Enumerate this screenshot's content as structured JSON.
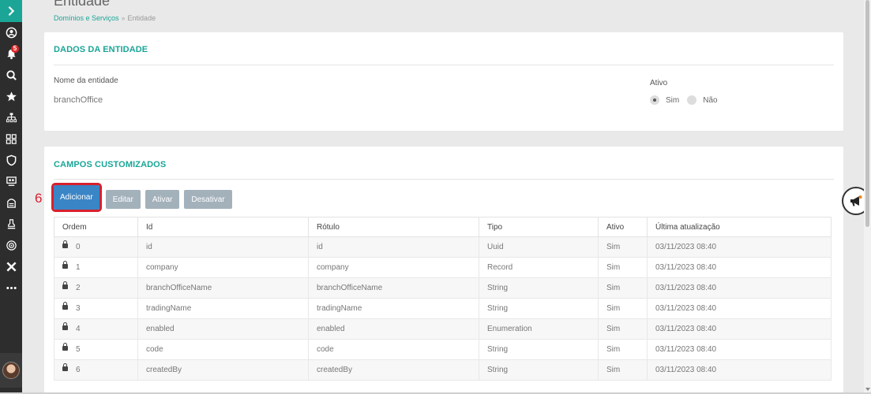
{
  "header": {
    "title": "Entidade",
    "breadcrumb": {
      "link": "Domínios e Serviços",
      "separator": "»",
      "current": "Entidade"
    }
  },
  "sidebar": {
    "notification_count": "5",
    "icons": [
      "user-circle-icon",
      "bell-icon",
      "search-icon",
      "star-icon",
      "hierarchy-icon",
      "team-icon",
      "shield-icon",
      "monitor-users-icon",
      "archive-icon",
      "stamp-icon",
      "target-icon",
      "x-icon",
      "more-icon"
    ]
  },
  "entity": {
    "section_title": "DADOS DA ENTIDADE",
    "name_label": "Nome da entidade",
    "name_value": "branchOffice",
    "active_label": "Ativo",
    "active_options": {
      "yes": "Sim",
      "no": "Não"
    },
    "active_selected": "Sim"
  },
  "custom_fields": {
    "section_title": "CAMPOS CUSTOMIZADOS",
    "step_number": "6",
    "buttons": {
      "add": "Adicionar",
      "edit": "Editar",
      "activate": "Ativar",
      "deactivate": "Desativar"
    },
    "columns": {
      "order": "Ordem",
      "id": "Id",
      "label": "Rótulo",
      "type": "Tipo",
      "active": "Ativo",
      "updated": "Última atualização"
    },
    "rows": [
      {
        "order": "0",
        "id": "id",
        "label": "id",
        "type": "Uuid",
        "active": "Sim",
        "updated": "03/11/2023 08:40"
      },
      {
        "order": "1",
        "id": "company",
        "label": "company",
        "type": "Record",
        "active": "Sim",
        "updated": "03/11/2023 08:40"
      },
      {
        "order": "2",
        "id": "branchOfficeName",
        "label": "branchOfficeName",
        "type": "String",
        "active": "Sim",
        "updated": "03/11/2023 08:40"
      },
      {
        "order": "3",
        "id": "tradingName",
        "label": "tradingName",
        "type": "String",
        "active": "Sim",
        "updated": "03/11/2023 08:40"
      },
      {
        "order": "4",
        "id": "enabled",
        "label": "enabled",
        "type": "Enumeration",
        "active": "Sim",
        "updated": "03/11/2023 08:40"
      },
      {
        "order": "5",
        "id": "code",
        "label": "code",
        "type": "String",
        "active": "Sim",
        "updated": "03/11/2023 08:40"
      },
      {
        "order": "6",
        "id": "createdBy",
        "label": "createdBy",
        "type": "String",
        "active": "Sim",
        "updated": "03/11/2023 08:40"
      }
    ]
  },
  "colors": {
    "accent": "#1aa597",
    "primary_button": "#3a85c6",
    "disabled_button": "#a3b1bb",
    "highlight": "#d8202c"
  }
}
